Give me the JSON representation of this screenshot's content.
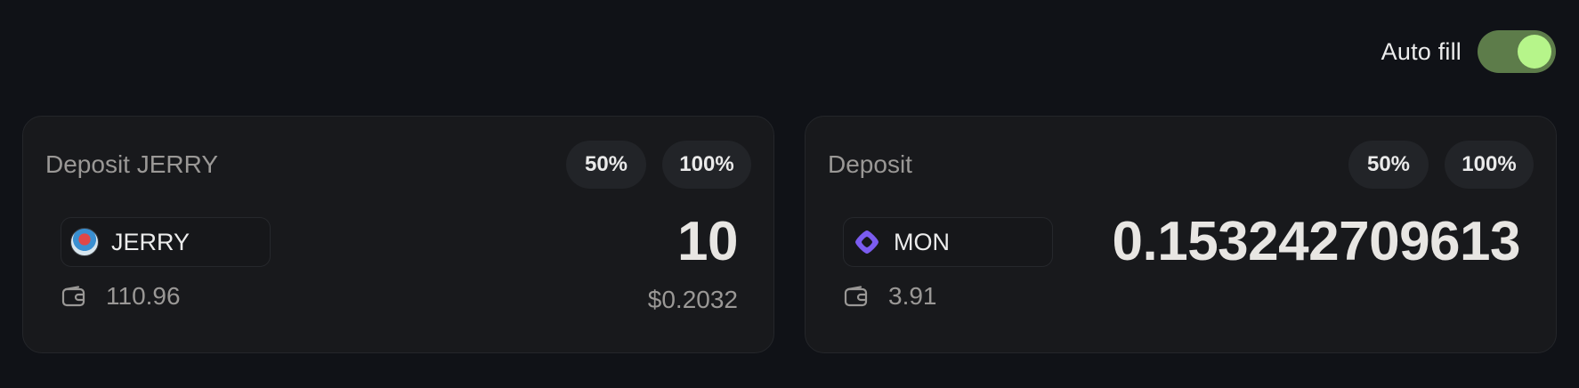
{
  "autofill": {
    "label": "Auto fill",
    "enabled": true,
    "accent": "#b6f58a"
  },
  "cards": [
    {
      "title": "Deposit JERRY",
      "pct_buttons": [
        "50%",
        "100%"
      ],
      "token": {
        "symbol": "JERRY",
        "icon": "jerry-token-icon"
      },
      "balance": "110.96",
      "amount": "10",
      "amount_usd": "$0.2032"
    },
    {
      "title": "Deposit",
      "pct_buttons": [
        "50%",
        "100%"
      ],
      "token": {
        "symbol": "MON",
        "icon": "mon-token-icon",
        "color": "#7b5cf0"
      },
      "balance": "3.91",
      "amount": "0.153242709613"
    }
  ]
}
